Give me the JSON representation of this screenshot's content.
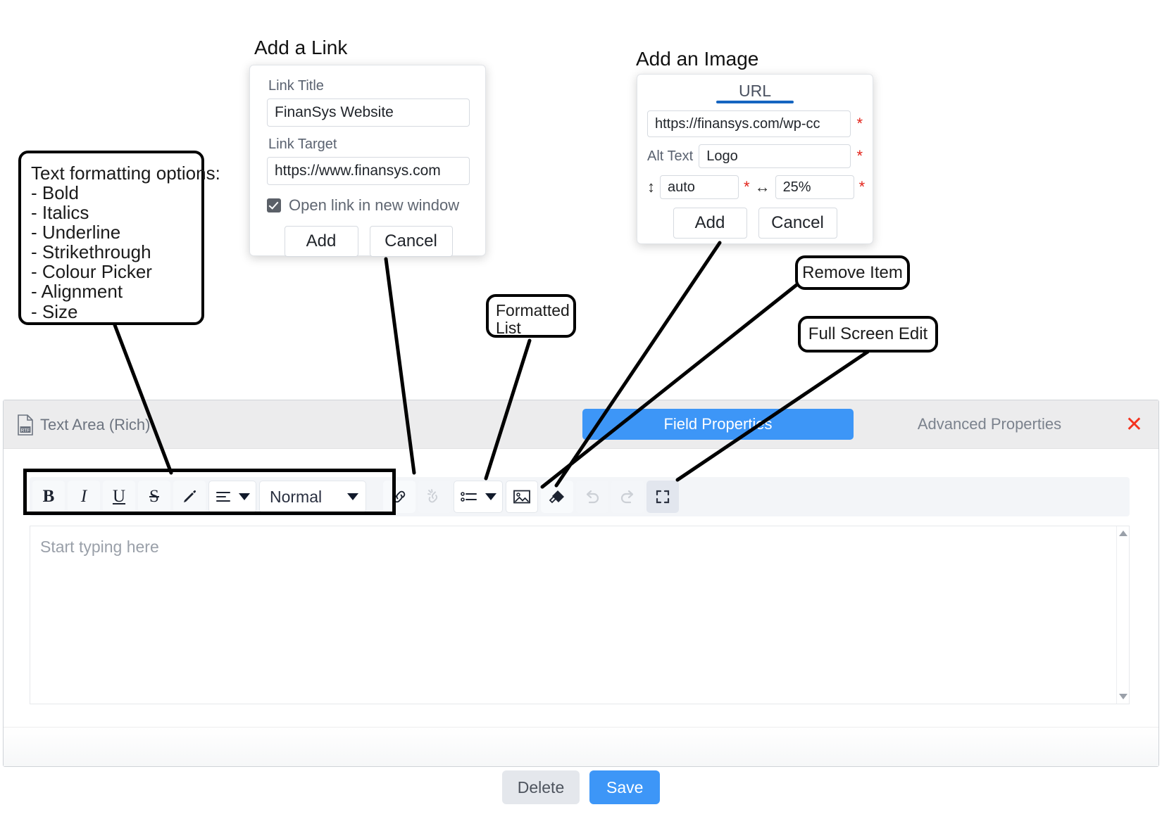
{
  "annotations": {
    "link_heading": "Add a Link",
    "image_heading": "Add an Image",
    "formatting_box": {
      "title": "Text formatting options:",
      "items": [
        "- Bold",
        "- Italics",
        "- Underline",
        "- Strikethrough",
        "- Colour Picker",
        "- Alignment",
        "- Size"
      ]
    },
    "formatted_list": [
      "Formatted",
      "List"
    ],
    "remove_item": "Remove Item",
    "full_screen_edit": "Full Screen Edit"
  },
  "link_dialog": {
    "title_label": "Link Title",
    "title_value": "FinanSys Website",
    "target_label": "Link Target",
    "target_value": "https://www.finansys.com",
    "checkbox_label": "Open link in new window",
    "checkbox_checked": true,
    "add_label": "Add",
    "cancel_label": "Cancel"
  },
  "image_dialog": {
    "tab_label": "URL",
    "url_value": "https://finansys.com/wp-cc",
    "alt_label": "Alt Text",
    "alt_value": "Logo",
    "height_value": "auto",
    "width_value": "25%",
    "required_marker": "*",
    "add_label": "Add",
    "cancel_label": "Cancel",
    "tab_accent": "#1565c0"
  },
  "panel": {
    "field_type": "Text Area (Rich)",
    "field_icon": "rtf-file-icon",
    "tabs": [
      {
        "label": "Field Properties",
        "active": true
      },
      {
        "label": "Advanced Properties",
        "active": false
      }
    ],
    "close_icon": "✕",
    "accent": "#3d96f7",
    "close_color": "#f4331f"
  },
  "toolbar": {
    "buttons": [
      {
        "name": "bold",
        "glyph": "B"
      },
      {
        "name": "italic",
        "glyph": "I"
      },
      {
        "name": "underline",
        "glyph": "U"
      },
      {
        "name": "strikethrough",
        "glyph": "S"
      },
      {
        "name": "colour-picker",
        "glyph": "pen-icon"
      },
      {
        "name": "alignment",
        "glyph": "align-left-icon"
      },
      {
        "name": "style",
        "glyph": "Normal"
      },
      {
        "name": "insert-link",
        "glyph": "link-icon"
      },
      {
        "name": "remove-link",
        "glyph": "unlink-icon",
        "disabled": true
      },
      {
        "name": "bullet-list",
        "glyph": "list-icon"
      },
      {
        "name": "insert-image",
        "glyph": "image-icon"
      },
      {
        "name": "remove-format",
        "glyph": "eraser-icon"
      },
      {
        "name": "undo",
        "glyph": "undo-icon",
        "disabled": true
      },
      {
        "name": "redo",
        "glyph": "redo-icon",
        "disabled": true
      },
      {
        "name": "full-screen",
        "glyph": "expand-icon",
        "pressed": true
      }
    ],
    "style_value": "Normal"
  },
  "editor": {
    "placeholder": "Start typing here"
  },
  "footer": {
    "delete_label": "Delete",
    "save_label": "Save"
  }
}
